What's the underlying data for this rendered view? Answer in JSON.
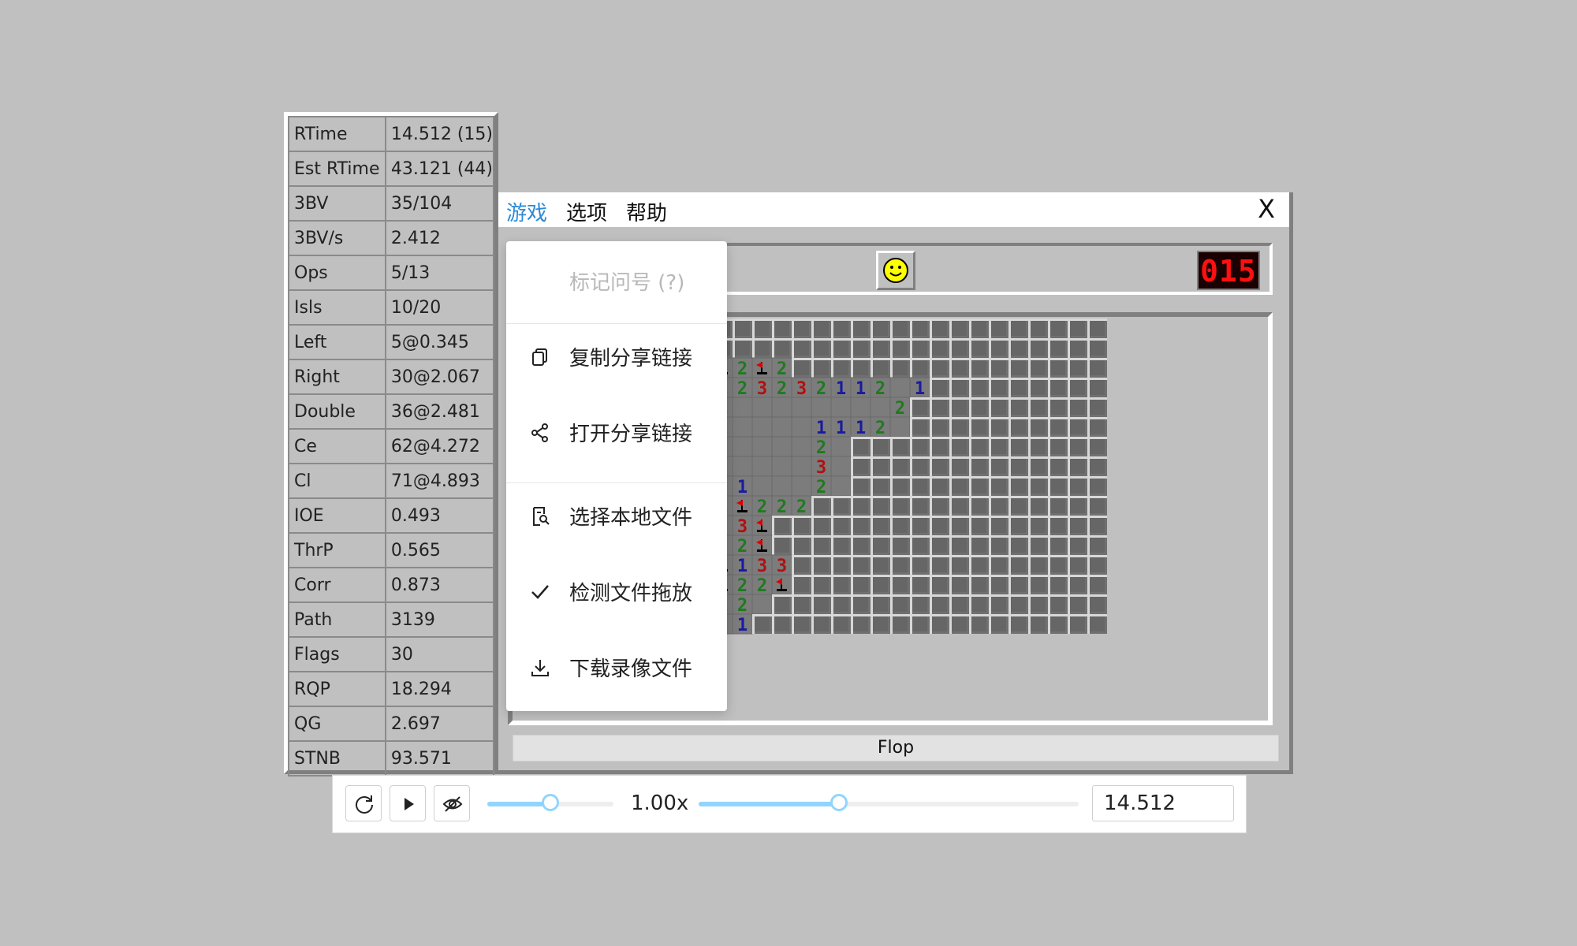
{
  "stats": [
    {
      "label": "RTime",
      "value": "14.512 (15)"
    },
    {
      "label": "Est RTime",
      "value": "43.121 (44)"
    },
    {
      "label": "3BV",
      "value": "35/104"
    },
    {
      "label": "3BV/s",
      "value": "2.412"
    },
    {
      "label": "Ops",
      "value": "5/13"
    },
    {
      "label": "Isls",
      "value": "10/20"
    },
    {
      "label": "Left",
      "value": "5@0.345"
    },
    {
      "label": "Right",
      "value": "30@2.067"
    },
    {
      "label": "Double",
      "value": "36@2.481"
    },
    {
      "label": "Ce",
      "value": "62@4.272"
    },
    {
      "label": "Cl",
      "value": "71@4.893"
    },
    {
      "label": "IOE",
      "value": "0.493"
    },
    {
      "label": "ThrP",
      "value": "0.565"
    },
    {
      "label": "Corr",
      "value": "0.873"
    },
    {
      "label": "Path",
      "value": "3139"
    },
    {
      "label": "Flags",
      "value": "30"
    },
    {
      "label": "RQP",
      "value": "18.294"
    },
    {
      "label": "QG",
      "value": "2.697"
    },
    {
      "label": "STNB",
      "value": "93.571"
    }
  ],
  "menubar": {
    "game": "游戏",
    "options": "选项",
    "help": "帮助",
    "close": "X"
  },
  "dropdown": {
    "mark_question": "标记问号 (?)",
    "copy_link": "复制分享链接",
    "open_link": "打开分享链接",
    "choose_file": "选择本地文件",
    "detect_drag": "检测文件拖放",
    "download_video": "下载录像文件"
  },
  "game": {
    "timer": "015",
    "status": "Flop"
  },
  "board": {
    "cols": 30,
    "rows": 16,
    "cells": [
      "UUUUUUUUUUUUUUUUUUUUUUUUUUUUUU",
      "UUUUUUUUUUUUUUUUUUUUUUUUUUUUUU",
      "UUUUUUUUU2F2F2UUUUUUUUUUUUUUUU",
      "UUUUUUUUU012323211201UUUUUUUUU",
      "UUUUUUUUU01000000002UUUUUUUUUU",
      "UUUUUUUUU31000011120UUUUUUUUUU",
      "UUUUUUUUU10000020UUUUUUUUUUUUU",
      "UUUUUUUUU20000030UUUUUUUUUUUUU",
      "UUUUUUUUU32100020UUUUUUUUUUUUU",
      "UUUUUUUUU21F222UUUUUUUUUUUUUUU",
      "UUUUUUUUU223FUUUUUUUUUUUUUUUUU",
      "UUUUUUUUU002FUUUUUUUUUUUUUUUUU",
      "UUUUUUUUU0F133UUUUUUUUUUUUUUUU",
      "UUUUUUUUU3F22FUUUUUUUUUUUUUUUU",
      "UUUUUUUUU4120UUUUUUUUUUUUUUUUU",
      "U2UUUU11F101UUUUUUUUUUUUUUUUUU"
    ]
  },
  "controls": {
    "speed": "1.00x",
    "speed_fraction": 0.5,
    "progress_fraction": 0.37,
    "time_value": "14.512"
  },
  "colors": {
    "n1": "#1a1aa0",
    "n2": "#1f7a1f",
    "n3": "#b01010",
    "n4": "#00007b",
    "accent": "#2d8ad6",
    "slider": "#91d5ff"
  }
}
